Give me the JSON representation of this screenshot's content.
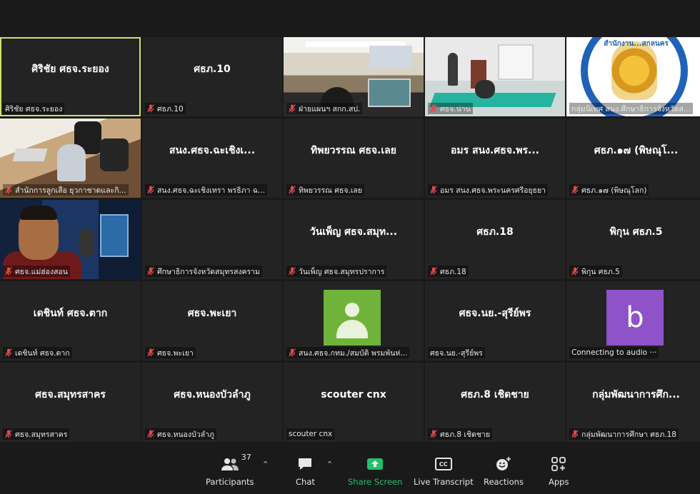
{
  "tiles": [
    {
      "big": "ศิริชัย ศธจ.ระยอง",
      "label": "ศิริชัย ศธจ.ระยอง",
      "muted": false,
      "active": true,
      "video": ""
    },
    {
      "big": "ศธภ.10",
      "label": "ศธภ.10",
      "muted": true,
      "video": ""
    },
    {
      "big": "",
      "label": "ฝ่ายแผนฯ สกก.สป.",
      "muted": true,
      "video": "office"
    },
    {
      "big": "",
      "label": "ศธจ.น่าน",
      "muted": true,
      "video": "room"
    },
    {
      "big": "",
      "label": "กลุ่มนิเทศ สนง.ศึกษาธิการจังหวัดส...",
      "muted": false,
      "video": "logo",
      "logo_text": "สำนักงาน...สกลนคร"
    },
    {
      "big": "",
      "label": "สำนักการลูกเสือ ยุวกาชาดและกิ...",
      "muted": true,
      "video": "meeting"
    },
    {
      "big": "สนง.ศธจ.ฉะเชิงเ...",
      "label": "สนง.ศธจ.ฉะเชิงเทรา พรธิภา ฉ...",
      "muted": true,
      "video": ""
    },
    {
      "big": "ทิพยวรรณ ศธจ.เลย",
      "label": "ทิพยวรรณ ศธจ.เลย",
      "muted": true,
      "video": ""
    },
    {
      "big": "อมร สนง.ศธจ.พร...",
      "label": "อมร สนง.ศธจ.พระนครศรีอยุธยา",
      "muted": true,
      "video": ""
    },
    {
      "big": "ศธภ.๑๗ (พิษณุโ...",
      "label": "ศธภ.๑๗ (พิษณุโลก)",
      "muted": true,
      "video": ""
    },
    {
      "big": "",
      "label": "ศธจ.แม่ฮ่องสอน",
      "muted": true,
      "video": "man"
    },
    {
      "big": "",
      "label": "ศึกษาธิการจังหวัดสมุทรสงคราม",
      "muted": true,
      "video": ""
    },
    {
      "big": "วันเพ็ญ ศธจ.สมุท...",
      "label": "วันเพ็ญ ศธจ.สมุทรปราการ",
      "muted": true,
      "video": ""
    },
    {
      "big": "ศธภ.18",
      "label": "ศธภ.18",
      "muted": true,
      "video": ""
    },
    {
      "big": "พิกุน ศธภ.5",
      "label": "พิกุน ศธภ.5",
      "muted": true,
      "video": ""
    },
    {
      "big": "เดชินท์ ศธจ.ตาก",
      "label": "เดชินท์ ศธจ.ตาก",
      "muted": true,
      "video": ""
    },
    {
      "big": "ศธจ.พะเยา",
      "label": "ศธจ.พะเยา",
      "muted": true,
      "video": ""
    },
    {
      "big": "",
      "label": "สนง.ศธจ.กทม./สมบัติ พรมพันห่...",
      "muted": true,
      "video": "avatar-green"
    },
    {
      "big": "ศธจ.นย.-สุรีย์พร",
      "label": "ศธจ.นย.-สุรีย์พร",
      "muted": false,
      "video": ""
    },
    {
      "big": "",
      "label": "Connecting to audio ···",
      "muted": false,
      "video": "avatar-purple",
      "avatar_letter": "b"
    },
    {
      "big": "ศธจ.สมุทรสาคร",
      "label": "ศธจ.สมุทรสาคร",
      "muted": true,
      "video": ""
    },
    {
      "big": "ศธจ.หนองบัวลำภู",
      "label": "ศธจ.หนองบัวลำภู",
      "muted": true,
      "video": ""
    },
    {
      "big": "scouter cnx",
      "label": "scouter cnx",
      "muted": false,
      "video": ""
    },
    {
      "big": "ศธภ.8 เชิดชาย",
      "label": "ศธภ.8 เชิดชาย",
      "muted": true,
      "video": ""
    },
    {
      "big": "กลุ่มพัฒนาการศึก...",
      "label": "กลุ่มพัฒนาการศึกษา ศธภ.18",
      "muted": true,
      "video": ""
    }
  ],
  "toolbar": {
    "participants_label": "Participants",
    "participants_count": "37",
    "chat_label": "Chat",
    "share_label": "Share Screen",
    "transcript_label": "Live Transcript",
    "reactions_label": "Reactions",
    "apps_label": "Apps",
    "cc_text": "CC"
  },
  "colors": {
    "active_border": "#c9e56b",
    "share_green": "#22c06a",
    "mute_red": "#e24a4a"
  }
}
